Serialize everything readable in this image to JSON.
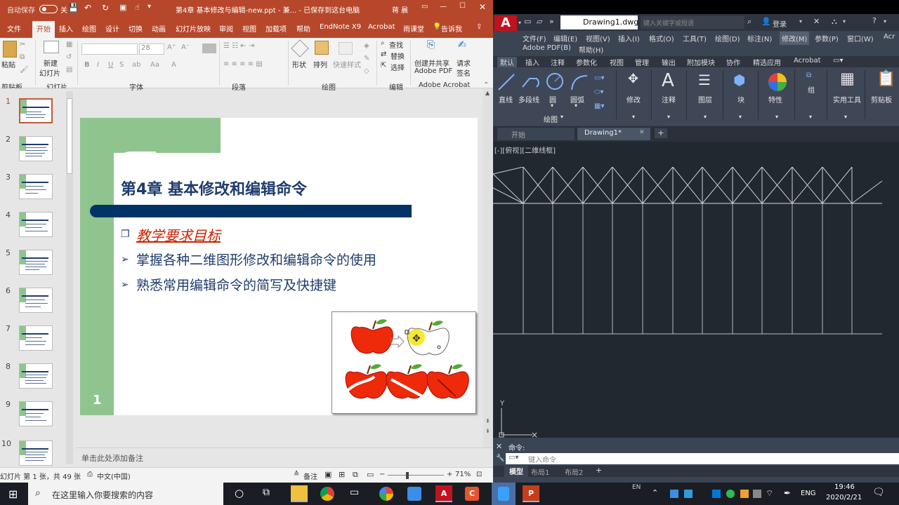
{
  "ppt": {
    "autosave": "自动保存",
    "autosave_state": "关",
    "title": "第4章 基本修改与编辑-new.ppt  -  兼...  -  已保存到这台电脑",
    "user": "蒋 晨",
    "menu": [
      "文件",
      "开始",
      "插入",
      "绘图",
      "设计",
      "切换",
      "动画",
      "幻灯片放映",
      "审阅",
      "视图",
      "加载项",
      "帮助",
      "EndNote X9",
      "Acrobat",
      "雨课堂",
      "告诉我"
    ],
    "ribbon": {
      "paste": "粘贴",
      "clipboard": "剪贴板",
      "new_slide_1": "新建",
      "new_slide_2": "幻灯片",
      "slides": "幻灯片",
      "font_size": "28",
      "font": "字体",
      "paragraph": "段落",
      "shapes": "形状",
      "arrange": "排列",
      "quick_styles": "快速样式",
      "drawing": "绘图",
      "find": "查找",
      "replace": "替换",
      "select": "选择",
      "editing": "编辑",
      "create_share_1": "创建并共享",
      "create_share_2": "Adobe PDF",
      "request_sign_1": "请求",
      "request_sign_2": "签名",
      "adobe_acrobat": "Adobe Acrobat"
    },
    "thumb_numbers": [
      "1",
      "2",
      "3",
      "4",
      "5",
      "6",
      "7",
      "8",
      "9",
      "10"
    ],
    "slide": {
      "title": "第4章 基本修改和编辑命令",
      "bullet_heading": "教学要求目标",
      "bullets": [
        "掌握各种二维图形修改和编辑命令的使用",
        "熟悉常用编辑命令的简写及快捷键"
      ],
      "number": "1"
    },
    "notes_placeholder": "单击此处添加备注",
    "status": {
      "slide_info": "幻灯片 第 1 张，共 49 张",
      "language": "中文(中国)",
      "notes": "备注",
      "zoom": "71%"
    }
  },
  "cad": {
    "file_title": "Drawing1.dwg",
    "search_placeholder": "键入关键字或短语",
    "login": "登录",
    "menu_row1": [
      "文件(F)",
      "编辑(E)",
      "视图(V)",
      "插入(I)",
      "格式(O)",
      "工具(T)",
      "绘图(D)",
      "标注(N)",
      "修改(M)",
      "参数(P)",
      "窗口(W)",
      "Acr"
    ],
    "menu_row2": [
      "Adobe PDF(B)",
      "帮助(H)"
    ],
    "ribbon_tabs": [
      "默认",
      "插入",
      "注释",
      "参数化",
      "视图",
      "管理",
      "输出",
      "附加模块",
      "协作",
      "精选应用",
      "Acrobat"
    ],
    "tools": {
      "line": "直线",
      "polyline": "多段线",
      "circle": "圆",
      "arc": "圆弧",
      "draw_group": "绘图",
      "modify": "修改",
      "annotation": "注释",
      "layers": "图层",
      "block": "块",
      "properties": "特性",
      "group": "组",
      "utilities": "实用工具",
      "clipboard": "剪贴板"
    },
    "doc_tabs": [
      "开始",
      "Drawing1*"
    ],
    "viewport_label": "[-][俯视][二维线框]",
    "axis_y": "Y",
    "command_label": "命令:",
    "command_placeholder": "键入命令",
    "layout_tabs": [
      "模型",
      "布局1",
      "布局2"
    ]
  },
  "taskbar": {
    "search_placeholder": "在这里输入你要搜索的内容",
    "ime": "EN",
    "lang": "ENG",
    "time": "19:46",
    "date": "2020/2/21"
  },
  "colors": {
    "ppt_accent": "#b7472a",
    "slide_green": "#8fc48f",
    "slide_navy": "#003366",
    "slide_red": "#cc2200",
    "cad_bg": "#212830"
  }
}
